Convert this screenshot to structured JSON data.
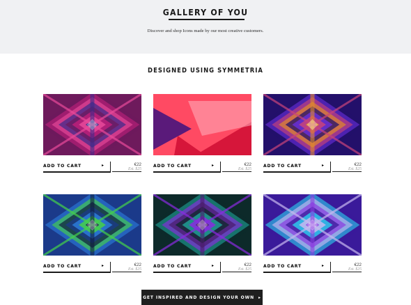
{
  "hero": {
    "title": "GALLERY OF YOU",
    "subtitle": "Discover and shop Icons made by our most creative customers."
  },
  "section": {
    "title": "DESIGNED USING SYMMETRIA"
  },
  "products": [
    {
      "cart_label": "ADD TO CART",
      "price": "€22",
      "est_price": "Est. $25",
      "palette": [
        "#6e1a5c",
        "#c21f7c",
        "#e84a9a",
        "#3a2a8a"
      ]
    },
    {
      "cart_label": "ADD TO CART",
      "price": "€22",
      "est_price": "Est. $25",
      "palette": [
        "#d6163a",
        "#ff4a63",
        "#5a1a7a",
        "#ffb3c0"
      ]
    },
    {
      "cart_label": "ADD TO CART",
      "price": "€22",
      "est_price": "Est. $25",
      "palette": [
        "#23106a",
        "#6a2ee0",
        "#c8447a",
        "#e08a2a"
      ]
    },
    {
      "cart_label": "ADD TO CART",
      "price": "€22",
      "est_price": "Est. $25",
      "palette": [
        "#1b3a8a",
        "#2d7fe0",
        "#45d14a",
        "#0f1a3c"
      ]
    },
    {
      "cart_label": "ADD TO CART",
      "price": "€22",
      "est_price": "Est. $25",
      "palette": [
        "#0d2a2a",
        "#1fa59a",
        "#8a2ae0",
        "#4a1a6a"
      ]
    },
    {
      "cart_label": "ADD TO CART",
      "price": "€22",
      "est_price": "Est. $25",
      "palette": [
        "#3a1a9a",
        "#2ad2f0",
        "#c8b8f0",
        "#8a3ae0"
      ]
    }
  ],
  "cta": {
    "label": "GET INSPIRED AND DESIGN YOUR OWN"
  },
  "icons": {
    "cart_arrow": "play-triangle-icon",
    "cta_arrow": "play-triangle-icon"
  }
}
